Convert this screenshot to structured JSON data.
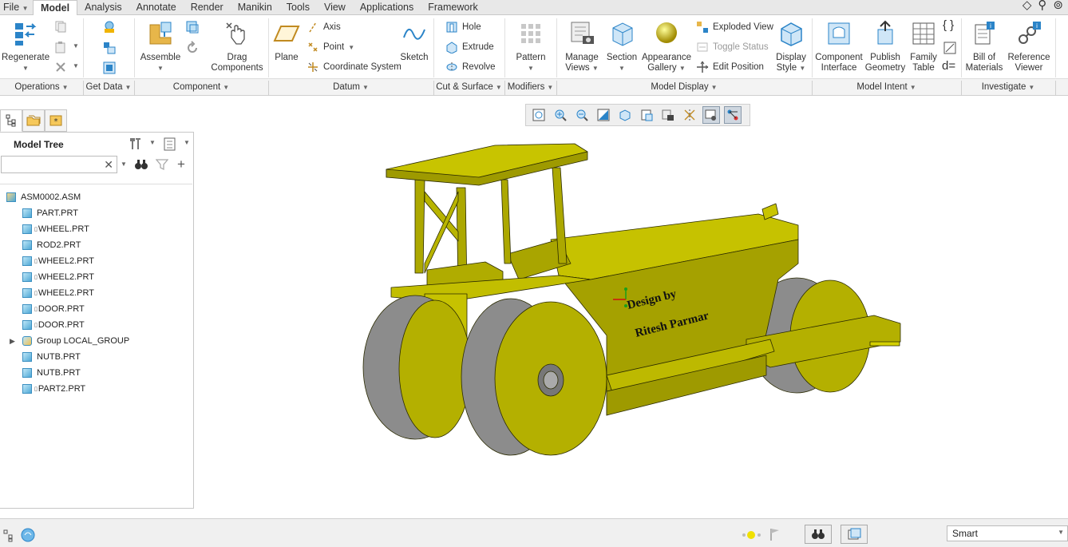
{
  "menu": {
    "tabs": [
      "File",
      "Model",
      "Analysis",
      "Annotate",
      "Render",
      "Manikin",
      "Tools",
      "View",
      "Applications",
      "Framework"
    ],
    "active": "Model"
  },
  "ribbon": {
    "regenerate": "Regenerate",
    "assemble": "Assemble",
    "drag": [
      "Drag",
      "Components"
    ],
    "plane": "Plane",
    "axis": "Axis",
    "point": "Point",
    "csys": "Coordinate System",
    "sketch": "Sketch",
    "hole": "Hole",
    "extrude": "Extrude",
    "revolve": "Revolve",
    "pattern": "Pattern",
    "manage_views": [
      "Manage",
      "Views"
    ],
    "section": "Section",
    "appearance": [
      "Appearance",
      "Gallery"
    ],
    "exploded": "Exploded View",
    "toggle_status": "Toggle Status",
    "edit_position": "Edit Position",
    "display_style": [
      "Display",
      "Style"
    ],
    "component_interface": [
      "Component",
      "Interface"
    ],
    "publish_geometry": [
      "Publish",
      "Geometry"
    ],
    "family_table": [
      "Family",
      "Table"
    ],
    "bill_of_materials": [
      "Bill of",
      "Materials"
    ],
    "reference_viewer": [
      "Reference",
      "Viewer"
    ]
  },
  "groups": [
    "Operations",
    "Get Data",
    "Component",
    "Datum",
    "Cut & Surface",
    "Modifiers",
    "Model Display",
    "Model Intent",
    "Investigate"
  ],
  "model_tree": {
    "title": "Model Tree",
    "items": [
      {
        "label": "ASM0002.ASM",
        "level": 0,
        "kind": "asm"
      },
      {
        "label": "PART.PRT",
        "level": 1,
        "kind": "prt"
      },
      {
        "label": "WHEEL.PRT",
        "level": 1,
        "kind": "prt",
        "mark": true
      },
      {
        "label": "ROD2.PRT",
        "level": 1,
        "kind": "prt"
      },
      {
        "label": "WHEEL2.PRT",
        "level": 1,
        "kind": "prt",
        "mark": true
      },
      {
        "label": "WHEEL2.PRT",
        "level": 1,
        "kind": "prt",
        "mark": true
      },
      {
        "label": "WHEEL2.PRT",
        "level": 1,
        "kind": "prt",
        "mark": true
      },
      {
        "label": "DOOR.PRT",
        "level": 1,
        "kind": "prt",
        "mark": true
      },
      {
        "label": "DOOR.PRT",
        "level": 1,
        "kind": "prt",
        "mark": true
      },
      {
        "label": "Group LOCAL_GROUP",
        "level": 1,
        "kind": "group",
        "expander": true
      },
      {
        "label": "NUTB.PRT",
        "level": 1,
        "kind": "prt"
      },
      {
        "label": "NUTB.PRT",
        "level": 1,
        "kind": "prt"
      },
      {
        "label": "PART2.PRT",
        "level": 1,
        "kind": "prt",
        "mark": true
      }
    ]
  },
  "model": {
    "annotation_line1": "Design by",
    "annotation_line2": "Ritesh Parmar",
    "body_color": "#b4b000",
    "wheel_gray": "#8c8c8c"
  },
  "status": {
    "selection_filter": "Smart"
  }
}
